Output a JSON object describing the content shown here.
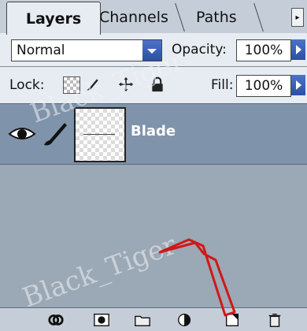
{
  "tabs": [
    {
      "label": "Layers",
      "active": true
    },
    {
      "label": "Channels",
      "active": false
    },
    {
      "label": "Paths",
      "active": false
    }
  ],
  "blend": {
    "mode": "Normal"
  },
  "opacity": {
    "label": "Opacity:",
    "value": "100%"
  },
  "lock": {
    "label": "Lock:"
  },
  "fill": {
    "label": "Fill:",
    "value": "100%"
  },
  "layers": [
    {
      "name": "Blade",
      "visible": true,
      "selected": true
    }
  ],
  "bottom_toolbar": [
    {
      "icon": "link-layers-icon"
    },
    {
      "icon": "layer-mask-icon"
    },
    {
      "icon": "new-group-icon"
    },
    {
      "icon": "adjustment-layer-icon"
    },
    {
      "icon": "new-layer-icon"
    },
    {
      "icon": "delete-layer-icon"
    }
  ],
  "watermark": "Black_Tiger",
  "colors": {
    "panel_bg": "#9ba8b5",
    "selected_layer": "#7f93aa",
    "control_bg": "#e6ecf2",
    "accent_blue": "#2a4fa5",
    "arrow_red": "#d01818"
  }
}
